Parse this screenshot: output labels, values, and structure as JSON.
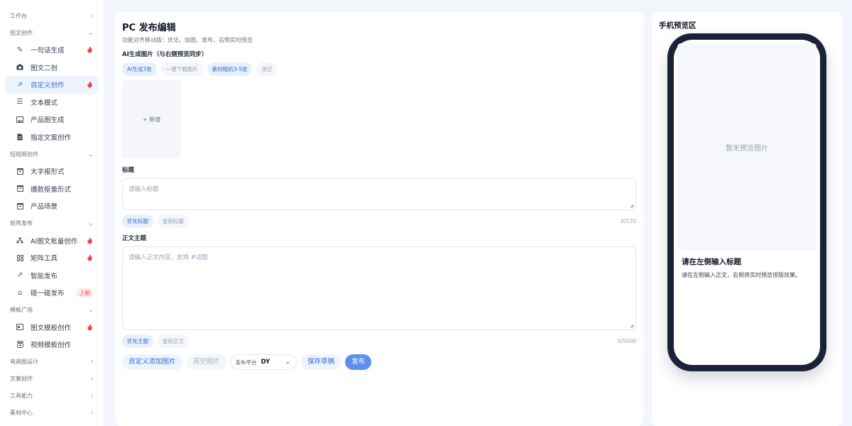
{
  "sidebar": {
    "sections": [
      {
        "label": "工作台",
        "chevron": "right",
        "items": []
      },
      {
        "label": "图文创作",
        "chevron": "down",
        "items": [
          {
            "label": "一句话生成",
            "icon": "pencil-icon",
            "badge": "hot"
          },
          {
            "label": "图文二创",
            "icon": "camera-icon"
          },
          {
            "label": "自定义创作",
            "icon": "share-arrow-icon",
            "badge": "hot",
            "active": true
          },
          {
            "label": "文本模式",
            "icon": "document-icon"
          },
          {
            "label": "产品图生成",
            "icon": "image-icon"
          },
          {
            "label": "指定文案创作",
            "icon": "file-icon"
          }
        ]
      },
      {
        "label": "短视频创作",
        "chevron": "down",
        "items": [
          {
            "label": "大字报形式",
            "icon": "calendar-icon"
          },
          {
            "label": "爆款抠像形式",
            "icon": "calendar-icon"
          },
          {
            "label": "产品场景",
            "icon": "calendar-icon"
          }
        ]
      },
      {
        "label": "矩阵发布",
        "chevron": "down",
        "items": [
          {
            "label": "AI图文批量创作",
            "icon": "sitemap-icon",
            "badge": "hot"
          },
          {
            "label": "矩阵工具",
            "icon": "grid-icon",
            "badge": "hot"
          },
          {
            "label": "智能发布",
            "icon": "share-arrow-icon"
          },
          {
            "label": "碰一碰发布",
            "icon": "home-icon",
            "badge_text": "上新"
          }
        ]
      },
      {
        "label": "模板广场",
        "chevron": "down",
        "items": [
          {
            "label": "图文模板创作",
            "icon": "template-icon",
            "badge": "hot"
          },
          {
            "label": "视频模板创作",
            "icon": "video-template-icon"
          }
        ]
      },
      {
        "label": "电商图设计",
        "chevron": "right",
        "items": []
      },
      {
        "label": "文案创作",
        "chevron": "right",
        "items": []
      },
      {
        "label": "工具能力",
        "chevron": "right",
        "items": []
      },
      {
        "label": "素材中心",
        "chevron": "right",
        "items": []
      }
    ]
  },
  "editor": {
    "title": "PC 发布编辑",
    "subtitle": "功能对齐移动版：优化、加图、发布，右侧实时预览",
    "ai_images_label": "AI生成图片（与右侧预览同步）",
    "ai_chips": [
      "AI生成3张",
      "一键下载图片",
      "素材随机3-5张",
      "清空"
    ],
    "add_label": "+ 新增",
    "title_label": "标题",
    "title_placeholder": "请输入标题",
    "title_chips": [
      "优化标题",
      "复制标题"
    ],
    "title_counter": "0/120",
    "body_label": "正文主题",
    "body_placeholder": "请输入正文内容，支持 #话题",
    "body_chips": [
      "优化主题",
      "复制正文"
    ],
    "body_counter": "0/5000",
    "actions": {
      "custom_add": "自定义添加图片",
      "clear_images": "清空图片",
      "platform_label": "发布平台",
      "platform_value": "DY",
      "save_draft": "保存草稿",
      "publish": "发布"
    }
  },
  "preview": {
    "heading": "手机预览区",
    "no_image": "暂无预览图片",
    "title": "请在左侧输入标题",
    "body": "请在左侧输入正文，右侧将实时预览排版效果。"
  }
}
